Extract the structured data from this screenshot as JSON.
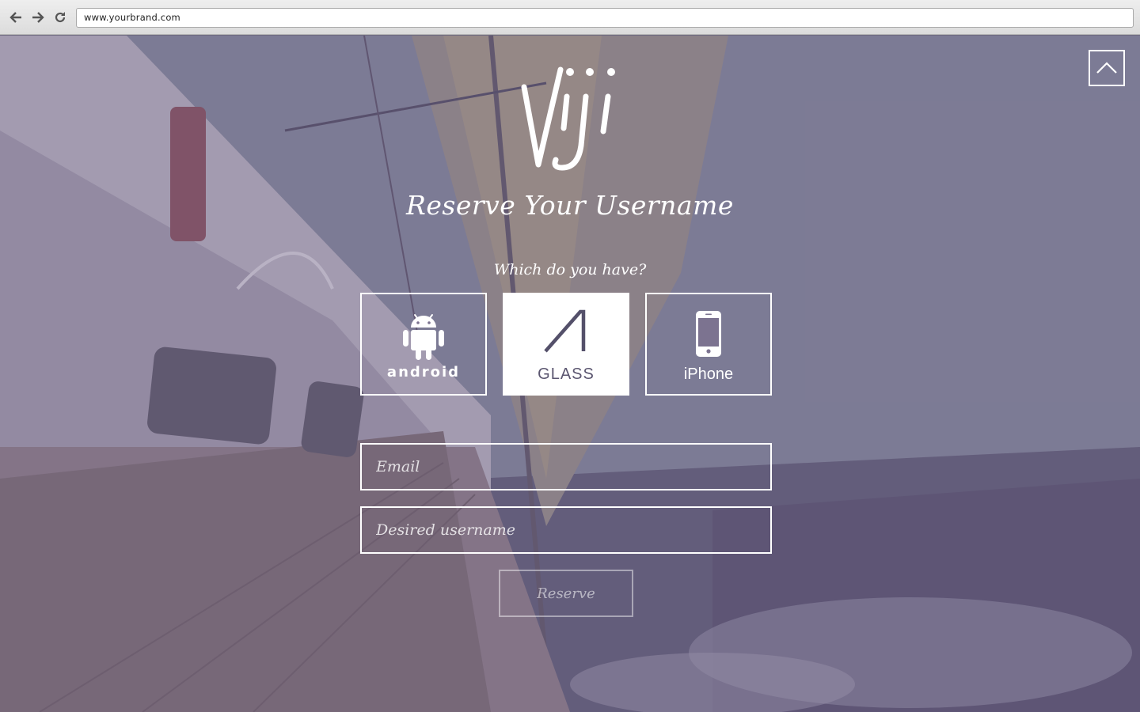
{
  "browser": {
    "url": "www.yourbrand.com",
    "back_icon": "arrow-left-icon",
    "forward_icon": "arrow-right-icon",
    "reload_icon": "reload-icon"
  },
  "page": {
    "logo_icon": "viji-logo",
    "title": "Reserve Your Username",
    "question": "Which do you have?",
    "back_to_top_icon": "chevron-up-icon",
    "devices": [
      {
        "label": "android",
        "icon": "android-robot-icon",
        "selected": false
      },
      {
        "label": "GLASS",
        "icon": "glass-icon",
        "selected": true
      },
      {
        "label": "iPhone",
        "icon": "iphone-icon",
        "selected": false
      }
    ],
    "form": {
      "email_placeholder": "Email",
      "email_value": "",
      "username_placeholder": "Desired username",
      "username_value": "",
      "submit_label": "Reserve"
    }
  },
  "colors": {
    "overlay": "#6e6487",
    "foreground": "#ffffff",
    "selected_text": "#5b5670"
  }
}
